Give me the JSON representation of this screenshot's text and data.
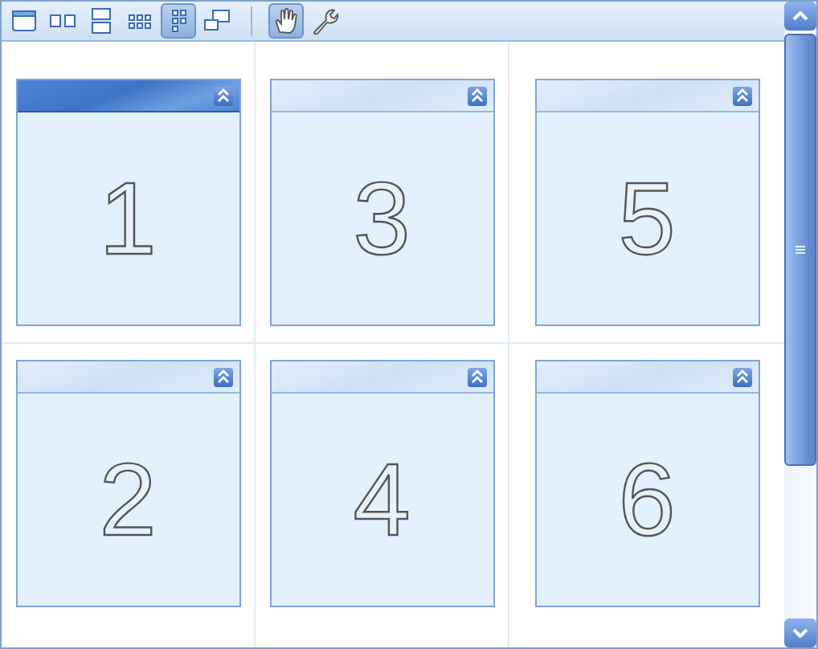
{
  "toolbar": {
    "layout_tools": [
      {
        "kind": "single",
        "selected": false
      },
      {
        "kind": "two-columns",
        "selected": false
      },
      {
        "kind": "two-rows",
        "selected": false
      },
      {
        "kind": "grid-dots",
        "selected": false
      },
      {
        "kind": "column-dots",
        "selected": true
      },
      {
        "kind": "cascade",
        "selected": false
      }
    ],
    "mode_tools": [
      {
        "kind": "hand",
        "selected": true
      },
      {
        "kind": "wrench",
        "selected": false
      }
    ]
  },
  "panels": [
    {
      "label": "1",
      "selected": true
    },
    {
      "label": "3",
      "selected": false
    },
    {
      "label": "5",
      "selected": false
    },
    {
      "label": "2",
      "selected": false
    },
    {
      "label": "4",
      "selected": false
    },
    {
      "label": "6",
      "selected": false
    }
  ]
}
